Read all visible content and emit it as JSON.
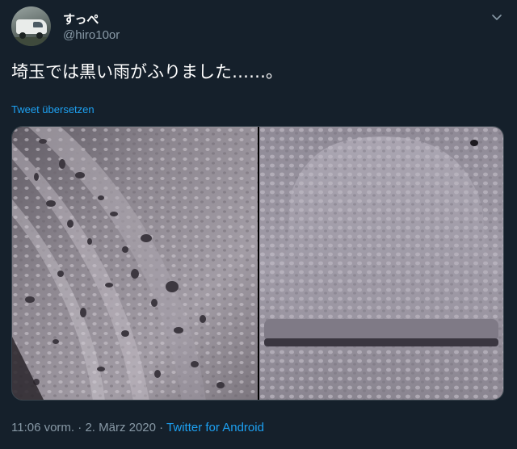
{
  "user": {
    "display_name": "すっぺ",
    "handle": "@hiro10or"
  },
  "tweet": {
    "text": "埼玉では黒い雨がふりました……。",
    "translate_label": "Tweet übersetzen",
    "time": "11:06 vorm.",
    "separator": " · ",
    "date": "2. März 2020",
    "separator2": " · ",
    "source": "Twitter for Android"
  },
  "icons": {
    "menu": "chevron-down-icon",
    "avatar": "avatar-van-photo"
  },
  "colors": {
    "background": "#15202b",
    "text_secondary": "#8899a6",
    "accent": "#1da1f2",
    "border": "#38444d"
  }
}
